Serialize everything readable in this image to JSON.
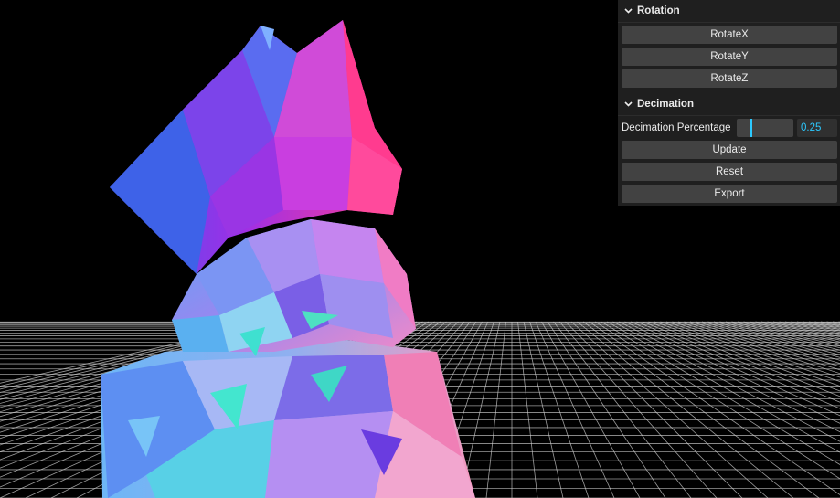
{
  "scene": {
    "background_color": "#000000",
    "grid_color": "#cfcfcf"
  },
  "gui": {
    "panel_color": "#1f1f1f",
    "accent_color": "#2cc9ff",
    "rotation": {
      "title": "Rotation",
      "buttons": [
        "RotateX",
        "RotateY",
        "RotateZ"
      ]
    },
    "decimation": {
      "title": "Decimation",
      "percentage_label": "Decimation Percentage",
      "percentage_value": "0.25",
      "percentage_fraction": 0.25,
      "buttons": [
        "Update",
        "Reset",
        "Export"
      ]
    }
  }
}
